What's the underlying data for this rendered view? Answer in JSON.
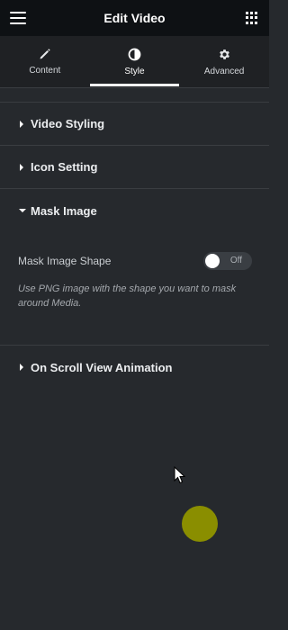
{
  "topbar": {
    "title": "Edit Video",
    "menu_icon": "hamburger-icon",
    "apps_icon": "grid-icon"
  },
  "tabs": [
    {
      "label": "Content",
      "icon": "pencil-icon",
      "active": false
    },
    {
      "label": "Style",
      "icon": "half-circle-icon",
      "active": true
    },
    {
      "label": "Advanced",
      "icon": "gear-icon",
      "active": false
    }
  ],
  "sections": {
    "video_styling": {
      "title": "Video Styling",
      "expanded": false
    },
    "icon_setting": {
      "title": "Icon Setting",
      "expanded": false
    },
    "mask_image": {
      "title": "Mask Image",
      "expanded": true,
      "control": {
        "label": "Mask Image Shape",
        "toggle_state": "Off",
        "hint": "Use PNG image with the shape you want to mask around Media."
      }
    },
    "scroll_animation": {
      "title": "On Scroll View Animation",
      "expanded": false
    }
  },
  "colors": {
    "background": "#26292d",
    "topbar": "#0e1114",
    "tabs_bg": "#1f2124",
    "indicator": "#8a8e00"
  }
}
